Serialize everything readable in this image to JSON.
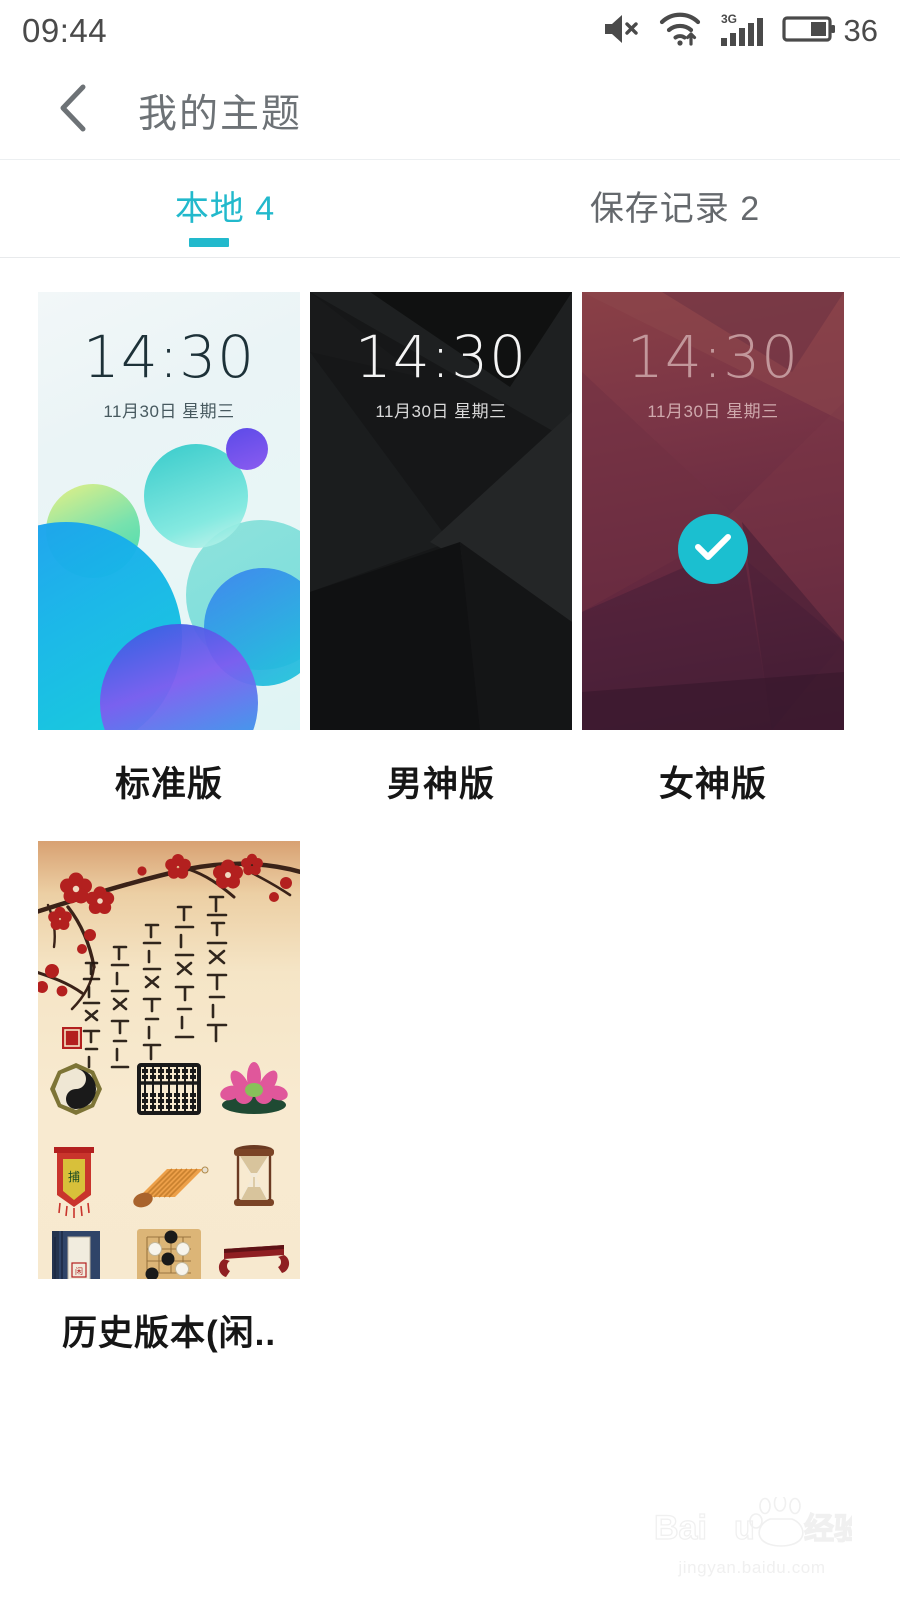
{
  "statusbar": {
    "clock": "09:44",
    "battery_level": "36",
    "network_label": "3G",
    "icons": [
      "volume-mute-icon",
      "wifi-icon",
      "signal-bars-icon",
      "battery-icon"
    ]
  },
  "titlebar": {
    "back_icon": "back-chevron-icon",
    "title": "我的主题"
  },
  "tabs": [
    {
      "label": "本地 4",
      "active": true
    },
    {
      "label": "保存记录 2",
      "active": false
    }
  ],
  "lockscreen": {
    "time": "14:30",
    "date": "11月30日 星期三"
  },
  "themes": [
    {
      "label": "标准版",
      "style": "light-bubbles",
      "selected": false,
      "shows_lockscreen": true
    },
    {
      "label": "男神版",
      "style": "dark-facets",
      "selected": false,
      "shows_lockscreen": true
    },
    {
      "label": "女神版",
      "style": "maroon-facets",
      "selected": true,
      "shows_lockscreen": true
    },
    {
      "label": "历史版本(闲..",
      "style": "chinese-painting",
      "selected": false,
      "shows_lockscreen": false
    }
  ],
  "colors": {
    "accent": "#22b9cc",
    "check_badge": "#1bbfd0",
    "title_text": "#6d7276",
    "tab_inactive": "#65696d",
    "label_text": "#161616"
  },
  "watermark": {
    "brand": "Baidu 经验",
    "url": "jingyan.baidu.com"
  }
}
